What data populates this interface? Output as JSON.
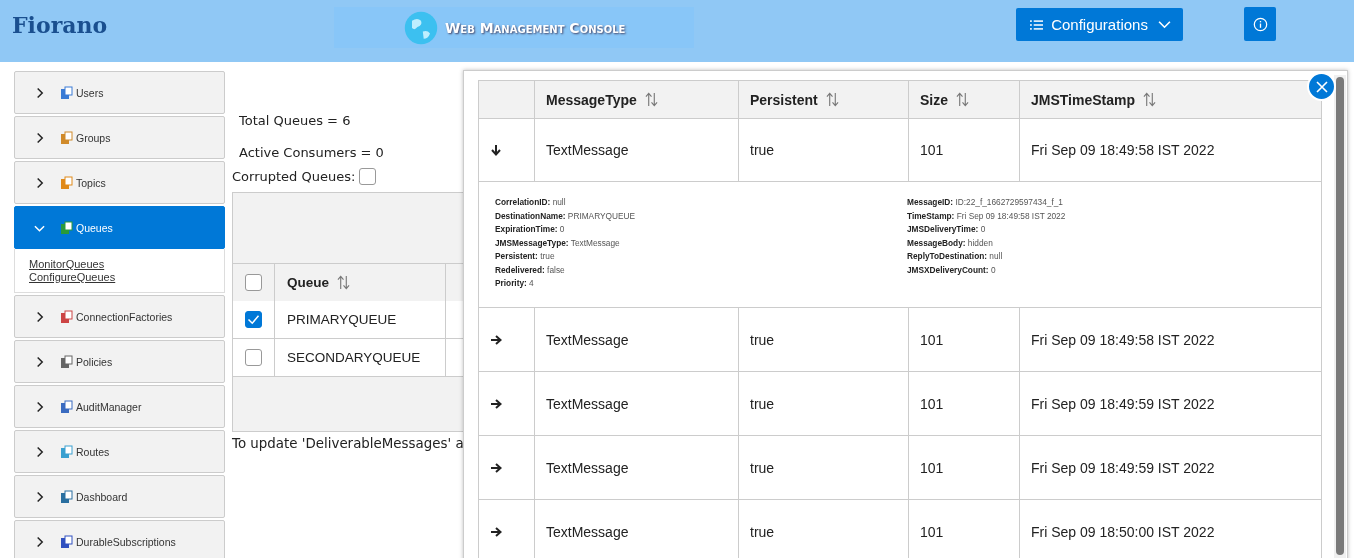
{
  "header": {
    "logo": "Fiorano",
    "banner": "Web Management Console",
    "menu_button": "Configurations"
  },
  "sidebar": {
    "items": [
      {
        "label": "Users",
        "expanded": false,
        "selected": false
      },
      {
        "label": "Groups",
        "expanded": false,
        "selected": false
      },
      {
        "label": "Topics",
        "expanded": false,
        "selected": false
      },
      {
        "label": "Queues",
        "expanded": true,
        "selected": true,
        "children": [
          {
            "label": "MonitorQueues"
          },
          {
            "label": "ConfigureQueues"
          }
        ]
      },
      {
        "label": "ConnectionFactories",
        "expanded": false,
        "selected": false
      },
      {
        "label": "Policies",
        "expanded": false,
        "selected": false
      },
      {
        "label": "AuditManager",
        "expanded": false,
        "selected": false
      },
      {
        "label": "Routes",
        "expanded": false,
        "selected": false
      },
      {
        "label": "Dashboard",
        "expanded": false,
        "selected": false
      },
      {
        "label": "DurableSubscriptions",
        "expanded": false,
        "selected": false
      }
    ]
  },
  "summary": {
    "total_queues": "Total Queues = 6",
    "active_consumers": "Active Consumers = 0",
    "corrupted_label": "Corrupted Queues:",
    "corrupted_checked": false
  },
  "queues_table": {
    "select_all_checked": false,
    "columns": [
      "Queue"
    ],
    "rows": [
      {
        "checked": true,
        "queue": "PRIMARYQUEUE"
      },
      {
        "checked": false,
        "queue": "SECONDARYQUEUE"
      }
    ]
  },
  "note": "To update 'DeliverableMessages' a",
  "messages_dialog": {
    "columns": [
      "MessageType",
      "Persistent",
      "Size",
      "JMSTimeStamp"
    ],
    "rows": [
      {
        "expanded": true,
        "cells": [
          "TextMessage",
          "true",
          "101",
          "Fri Sep 09 18:49:58 IST 2022"
        ],
        "details_left": [
          {
            "key": "CorrelationID:",
            "value": "null"
          },
          {
            "key": "DestinationName:",
            "value": "PRIMARYQUEUE"
          },
          {
            "key": "ExpirationTime:",
            "value": "0"
          },
          {
            "key": "JMSMessageType:",
            "value": "TextMessage"
          },
          {
            "key": "Persistent:",
            "value": "true"
          },
          {
            "key": "Redelivered:",
            "value": "false"
          },
          {
            "key": "Priority:",
            "value": "4"
          }
        ],
        "details_right": [
          {
            "key": "MessageID:",
            "value": "ID:22_f_1662729597434_f_1"
          },
          {
            "key": "TimeStamp:",
            "value": "Fri Sep 09 18:49:58 IST 2022"
          },
          {
            "key": "JMSDeliveryTime:",
            "value": "0"
          },
          {
            "key": "MessageBody:",
            "value": "hidden"
          },
          {
            "key": "ReplyToDestination:",
            "value": "null"
          },
          {
            "key": "JMSXDeliveryCount:",
            "value": "0"
          }
        ]
      },
      {
        "expanded": false,
        "cells": [
          "TextMessage",
          "true",
          "101",
          "Fri Sep 09 18:49:58 IST 2022"
        ]
      },
      {
        "expanded": false,
        "cells": [
          "TextMessage",
          "true",
          "101",
          "Fri Sep 09 18:49:59 IST 2022"
        ]
      },
      {
        "expanded": false,
        "cells": [
          "TextMessage",
          "true",
          "101",
          "Fri Sep 09 18:49:59 IST 2022"
        ]
      },
      {
        "expanded": false,
        "cells": [
          "TextMessage",
          "true",
          "101",
          "Fri Sep 09 18:50:00 IST 2022"
        ]
      }
    ]
  }
}
